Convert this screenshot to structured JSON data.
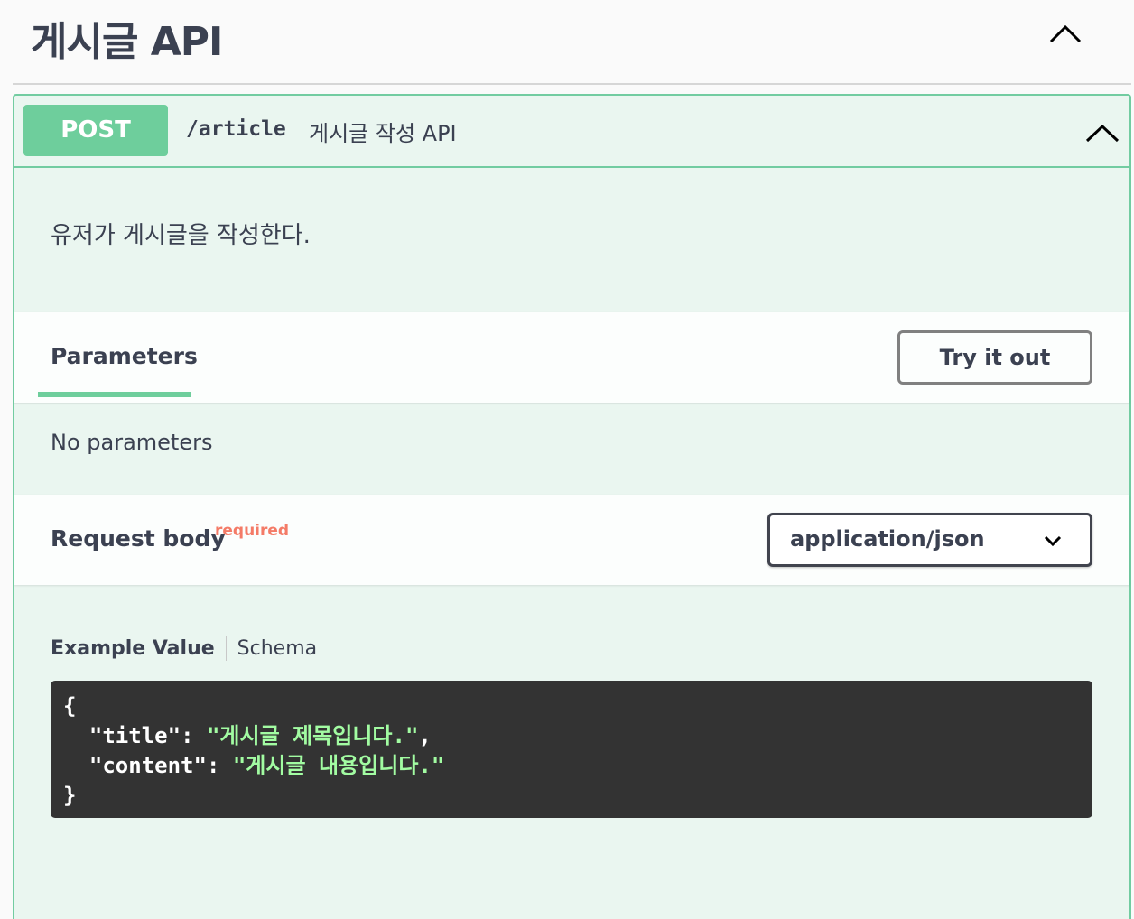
{
  "tag": {
    "title": "게시글 API"
  },
  "operation": {
    "method": "POST",
    "path": "/article",
    "summary": "게시글 작성 API",
    "description": "유저가 게시글을 작성한다."
  },
  "parameters": {
    "tab_label": "Parameters",
    "try_button": "Try it out",
    "empty_text": "No parameters"
  },
  "request_body": {
    "title": "Request body",
    "required_label": "required",
    "content_type": "application/json",
    "example_tab": "Example Value",
    "schema_tab": "Schema",
    "example": {
      "open_brace": "{",
      "close_brace": "}",
      "lines": [
        {
          "key": "\"title\"",
          "value": "\"게시글 제목입니다.\"",
          "trail": ","
        },
        {
          "key": "\"content\"",
          "value": "\"게시글 내용입니다.\"",
          "trail": ""
        }
      ]
    }
  },
  "colors": {
    "post_accent": "#6ece9c",
    "post_bg": "#eaf6f0",
    "required": "#f47b67",
    "code_bg": "#333333",
    "code_string": "#a2fca2"
  },
  "icons": {
    "tag_toggle": "chevron-up-icon",
    "op_toggle": "chevron-up-icon",
    "select_arrow": "chevron-down-icon"
  }
}
